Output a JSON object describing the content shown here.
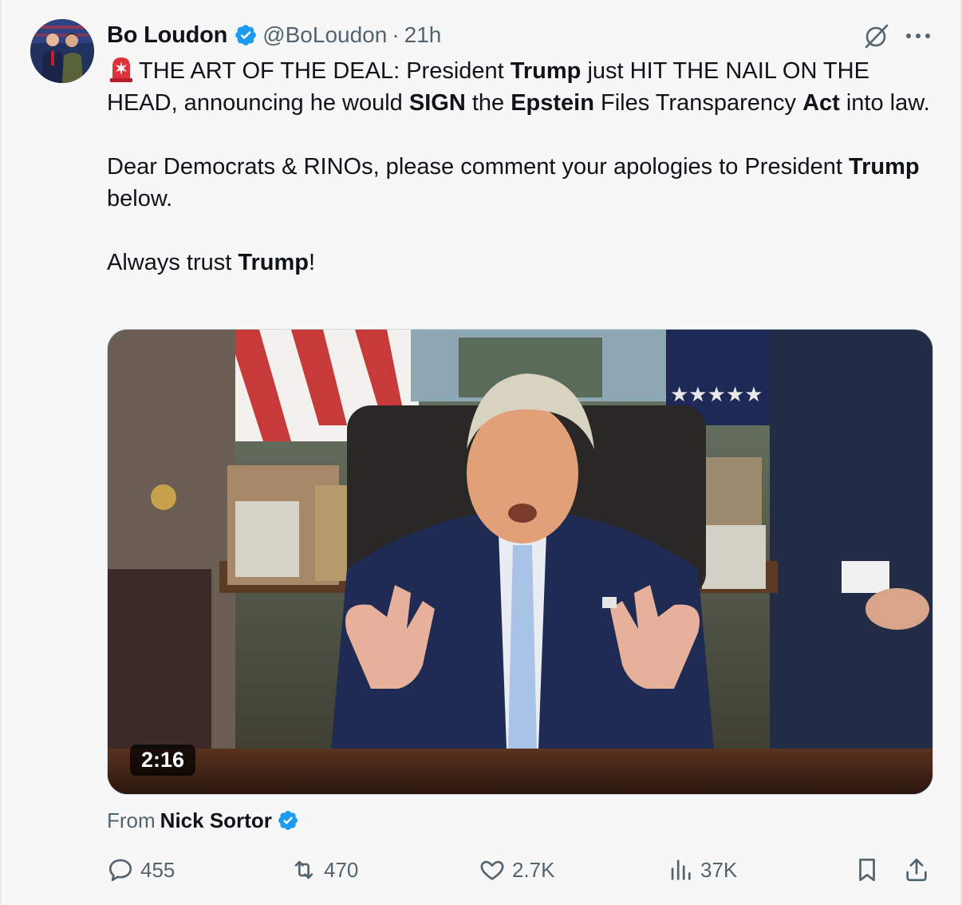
{
  "post": {
    "author_name": "Bo Loudon",
    "handle": "@BoLoudon",
    "separator": "·",
    "time": "21h",
    "text_lines": {
      "l1_a": "THE ART OF THE DEAL: President ",
      "l1_b": "Trump",
      "l1_c": " just HIT THE NAIL ON THE HEAD, announcing he would ",
      "l1_d": "SIGN",
      "l1_e": " the ",
      "l1_f": "Epstein",
      "l1_g": " Files Transparency ",
      "l1_h": "Act",
      "l1_i": " into law.",
      "p2_a": "Dear Democrats & RINOs, please comment your apologies to President ",
      "p2_b": "Trump",
      "p2_c": " below.",
      "p3_a": "Always trust ",
      "p3_b": "Trump",
      "p3_c": "!"
    }
  },
  "media": {
    "duration": "2:16"
  },
  "attribution": {
    "prefix": "From",
    "name": "Nick Sortor"
  },
  "actions": {
    "replies": "455",
    "reposts": "470",
    "likes": "2.7K",
    "views": "37K"
  },
  "icons": {
    "verified": "verified-badge-icon",
    "siren": "rotating-light-emoji",
    "grok": "grok-icon",
    "more": "more-dots-icon",
    "reply": "reply-icon",
    "repost": "repost-icon",
    "like": "heart-icon",
    "views": "analytics-icon",
    "bookmark": "bookmark-icon",
    "share": "share-icon"
  },
  "colors": {
    "verified_blue": "#1d9bf0",
    "text_primary": "#0f1419",
    "text_secondary": "#536471",
    "siren_red": "#e0323a"
  }
}
